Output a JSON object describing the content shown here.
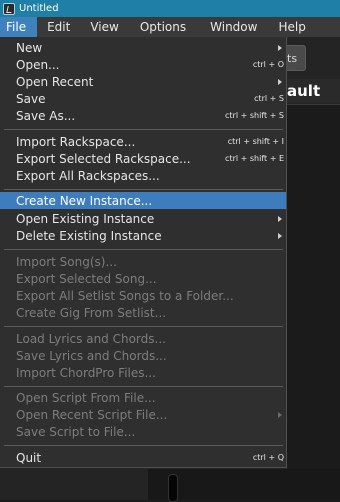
{
  "window": {
    "title": "Untitled"
  },
  "menubar": {
    "items": [
      {
        "label": "File"
      },
      {
        "label": "Edit"
      },
      {
        "label": "View"
      },
      {
        "label": "Options"
      },
      {
        "label": "Window"
      },
      {
        "label": "Help"
      }
    ],
    "active": "File"
  },
  "background": {
    "button_partial_label": "ts",
    "header_partial_label": "ault"
  },
  "file_menu": {
    "items": [
      {
        "label": "New",
        "shortcut": "",
        "submenu": true,
        "enabled": true
      },
      {
        "label": "Open...",
        "shortcut": "ctrl + O",
        "submenu": false,
        "enabled": true
      },
      {
        "label": "Open Recent",
        "shortcut": "",
        "submenu": true,
        "enabled": true
      },
      {
        "label": "Save",
        "shortcut": "ctrl + S",
        "submenu": false,
        "enabled": true
      },
      {
        "label": "Save As...",
        "shortcut": "ctrl + shift + S",
        "submenu": false,
        "enabled": true
      },
      {
        "label": "Import Rackspace...",
        "shortcut": "ctrl + shift + I",
        "submenu": false,
        "enabled": true
      },
      {
        "label": "Export Selected Rackspace...",
        "shortcut": "ctrl + shift + E",
        "submenu": false,
        "enabled": true
      },
      {
        "label": "Export All Rackspaces...",
        "shortcut": "",
        "submenu": false,
        "enabled": true
      },
      {
        "label": "Create New Instance...",
        "shortcut": "",
        "submenu": false,
        "enabled": true,
        "highlighted": true
      },
      {
        "label": "Open Existing Instance",
        "shortcut": "",
        "submenu": true,
        "enabled": true
      },
      {
        "label": "Delete Existing Instance",
        "shortcut": "",
        "submenu": true,
        "enabled": true
      },
      {
        "label": "Import Song(s)...",
        "shortcut": "",
        "submenu": false,
        "enabled": false
      },
      {
        "label": "Export Selected Song...",
        "shortcut": "",
        "submenu": false,
        "enabled": false
      },
      {
        "label": "Export All Setlist Songs to a Folder...",
        "shortcut": "",
        "submenu": false,
        "enabled": false
      },
      {
        "label": "Create Gig From Setlist...",
        "shortcut": "",
        "submenu": false,
        "enabled": false
      },
      {
        "label": "Load Lyrics and Chords...",
        "shortcut": "",
        "submenu": false,
        "enabled": false
      },
      {
        "label": "Save Lyrics and Chords...",
        "shortcut": "",
        "submenu": false,
        "enabled": false
      },
      {
        "label": "Import ChordPro Files...",
        "shortcut": "",
        "submenu": false,
        "enabled": false
      },
      {
        "label": "Open Script From File...",
        "shortcut": "",
        "submenu": false,
        "enabled": false
      },
      {
        "label": "Open Recent Script File...",
        "shortcut": "",
        "submenu": true,
        "enabled": false
      },
      {
        "label": "Save Script to File...",
        "shortcut": "",
        "submenu": false,
        "enabled": false
      },
      {
        "label": "Quit",
        "shortcut": "ctrl + Q",
        "submenu": false,
        "enabled": true
      }
    ]
  },
  "colors": {
    "titlebar": "#1f7fa6",
    "menu_bg": "#2f2f2f",
    "highlight": "#3d7dbe",
    "disabled_text": "#7d7d7d"
  }
}
